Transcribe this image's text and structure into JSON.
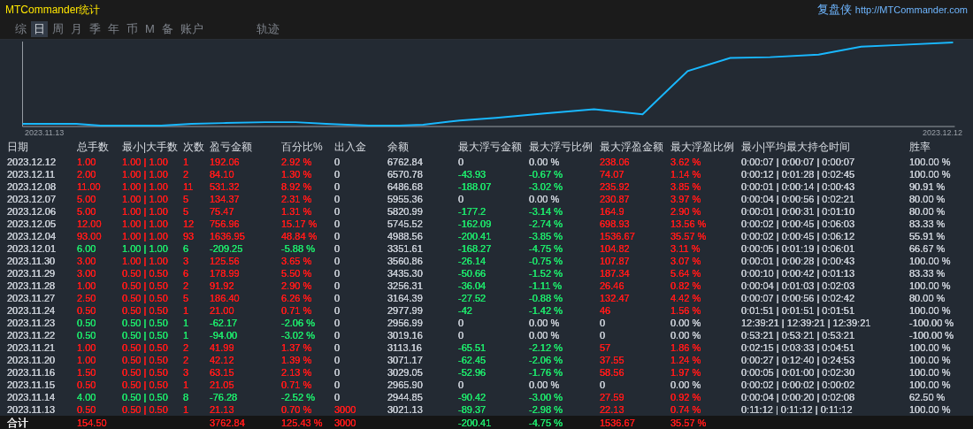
{
  "window": {
    "title": "MTCommander统计",
    "brand": "复盘侠",
    "url": "http://MTCommander.com"
  },
  "period_tabs": [
    {
      "label": "综",
      "selected": false
    },
    {
      "label": "日",
      "selected": true
    },
    {
      "label": "周",
      "selected": false
    },
    {
      "label": "月",
      "selected": false
    },
    {
      "label": "季",
      "selected": false
    },
    {
      "label": "年",
      "selected": false
    },
    {
      "label": "币",
      "selected": false
    },
    {
      "label": "M",
      "selected": false
    },
    {
      "label": "备",
      "selected": false
    },
    {
      "label": "账户",
      "selected": false
    }
  ],
  "view_tabs": [
    {
      "label": "轨迹",
      "selected": false
    }
  ],
  "chart": {
    "start_label": "2023.11.13",
    "end_label": "2023.12.12"
  },
  "table": {
    "columns": [
      "日期",
      "总手数",
      "最小|大手数",
      "次数",
      "盈亏金额",
      "百分比%",
      "出入金",
      "余额",
      "最大浮亏金额",
      "最大浮亏比例",
      "最大浮盈金额",
      "最大浮盈比例",
      "最小|平均最大持仓时间",
      "胜率"
    ],
    "rows": [
      [
        {
          "text": "2023.12.12",
          "color": "#c3c8d0"
        },
        {
          "text": "1.00",
          "color": "#ff1a1a"
        },
        {
          "text": "1.00 | 1.00",
          "color": "#ff1a1a"
        },
        {
          "text": "1",
          "color": "#ff1a1a"
        },
        {
          "text": "192.06",
          "color": "#ff1a1a"
        },
        {
          "text": "2.92 %",
          "color": "#ff1a1a"
        },
        {
          "text": "0",
          "color": "#c3c8d0"
        },
        {
          "text": "6762.84",
          "color": "#c3c8d0"
        },
        {
          "text": "0",
          "color": "#c3c8d0"
        },
        {
          "text": "0.00 %",
          "color": "#c3c8d0"
        },
        {
          "text": "238.06",
          "color": "#ff1a1a"
        },
        {
          "text": "3.62 %",
          "color": "#ff1a1a"
        },
        {
          "text": "0:00:07 | 0:00:07 | 0:00:07",
          "color": "#c3c8d0"
        },
        {
          "text": "100.00 %",
          "color": "#c3c8d0"
        }
      ],
      [
        {
          "text": "2023.12.11",
          "color": "#c3c8d0"
        },
        {
          "text": "2.00",
          "color": "#ff1a1a"
        },
        {
          "text": "1.00 | 1.00",
          "color": "#ff1a1a"
        },
        {
          "text": "2",
          "color": "#ff1a1a"
        },
        {
          "text": "84.10",
          "color": "#ff1a1a"
        },
        {
          "text": "1.30 %",
          "color": "#ff1a1a"
        },
        {
          "text": "0",
          "color": "#c3c8d0"
        },
        {
          "text": "6570.78",
          "color": "#c3c8d0"
        },
        {
          "text": "-43.93",
          "color": "#1ee36a"
        },
        {
          "text": "-0.67 %",
          "color": "#1ee36a"
        },
        {
          "text": "74.07",
          "color": "#ff1a1a"
        },
        {
          "text": "1.14 %",
          "color": "#ff1a1a"
        },
        {
          "text": "0:00:12 | 0:01:28 | 0:02:45",
          "color": "#c3c8d0"
        },
        {
          "text": "100.00 %",
          "color": "#c3c8d0"
        }
      ],
      [
        {
          "text": "2023.12.08",
          "color": "#c3c8d0"
        },
        {
          "text": "11.00",
          "color": "#ff1a1a"
        },
        {
          "text": "1.00 | 1.00",
          "color": "#ff1a1a"
        },
        {
          "text": "11",
          "color": "#ff1a1a"
        },
        {
          "text": "531.32",
          "color": "#ff1a1a"
        },
        {
          "text": "8.92 %",
          "color": "#ff1a1a"
        },
        {
          "text": "0",
          "color": "#c3c8d0"
        },
        {
          "text": "6486.68",
          "color": "#c3c8d0"
        },
        {
          "text": "-188.07",
          "color": "#1ee36a"
        },
        {
          "text": "-3.02 %",
          "color": "#1ee36a"
        },
        {
          "text": "235.92",
          "color": "#ff1a1a"
        },
        {
          "text": "3.85 %",
          "color": "#ff1a1a"
        },
        {
          "text": "0:00:01 | 0:00:14 | 0:00:43",
          "color": "#c3c8d0"
        },
        {
          "text": "90.91 %",
          "color": "#c3c8d0"
        }
      ],
      [
        {
          "text": "2023.12.07",
          "color": "#c3c8d0"
        },
        {
          "text": "5.00",
          "color": "#ff1a1a"
        },
        {
          "text": "1.00 | 1.00",
          "color": "#ff1a1a"
        },
        {
          "text": "5",
          "color": "#ff1a1a"
        },
        {
          "text": "134.37",
          "color": "#ff1a1a"
        },
        {
          "text": "2.31 %",
          "color": "#ff1a1a"
        },
        {
          "text": "0",
          "color": "#c3c8d0"
        },
        {
          "text": "5955.36",
          "color": "#c3c8d0"
        },
        {
          "text": "0",
          "color": "#c3c8d0"
        },
        {
          "text": "0.00 %",
          "color": "#c3c8d0"
        },
        {
          "text": "230.87",
          "color": "#ff1a1a"
        },
        {
          "text": "3.97 %",
          "color": "#ff1a1a"
        },
        {
          "text": "0:00:04 | 0:00:56 | 0:02:21",
          "color": "#c3c8d0"
        },
        {
          "text": "80.00 %",
          "color": "#c3c8d0"
        }
      ],
      [
        {
          "text": "2023.12.06",
          "color": "#c3c8d0"
        },
        {
          "text": "5.00",
          "color": "#ff1a1a"
        },
        {
          "text": "1.00 | 1.00",
          "color": "#ff1a1a"
        },
        {
          "text": "5",
          "color": "#ff1a1a"
        },
        {
          "text": "75.47",
          "color": "#ff1a1a"
        },
        {
          "text": "1.31 %",
          "color": "#ff1a1a"
        },
        {
          "text": "0",
          "color": "#c3c8d0"
        },
        {
          "text": "5820.99",
          "color": "#c3c8d0"
        },
        {
          "text": "-177.2",
          "color": "#1ee36a"
        },
        {
          "text": "-3.14 %",
          "color": "#1ee36a"
        },
        {
          "text": "164.9",
          "color": "#ff1a1a"
        },
        {
          "text": "2.90 %",
          "color": "#ff1a1a"
        },
        {
          "text": "0:00:01 | 0:00:31 | 0:01:10",
          "color": "#c3c8d0"
        },
        {
          "text": "80.00 %",
          "color": "#c3c8d0"
        }
      ],
      [
        {
          "text": "2023.12.05",
          "color": "#c3c8d0"
        },
        {
          "text": "12.00",
          "color": "#ff1a1a"
        },
        {
          "text": "1.00 | 1.00",
          "color": "#ff1a1a"
        },
        {
          "text": "12",
          "color": "#ff1a1a"
        },
        {
          "text": "756.96",
          "color": "#ff1a1a"
        },
        {
          "text": "15.17 %",
          "color": "#ff1a1a"
        },
        {
          "text": "0",
          "color": "#c3c8d0"
        },
        {
          "text": "5745.52",
          "color": "#c3c8d0"
        },
        {
          "text": "-162.09",
          "color": "#1ee36a"
        },
        {
          "text": "-2.74 %",
          "color": "#1ee36a"
        },
        {
          "text": "698.93",
          "color": "#ff1a1a"
        },
        {
          "text": "13.56 %",
          "color": "#ff1a1a"
        },
        {
          "text": "0:00:02 | 0:00:45 | 0:06:03",
          "color": "#c3c8d0"
        },
        {
          "text": "83.33 %",
          "color": "#c3c8d0"
        }
      ],
      [
        {
          "text": "2023.12.04",
          "color": "#c3c8d0"
        },
        {
          "text": "93.00",
          "color": "#ff1a1a"
        },
        {
          "text": "1.00 | 1.00",
          "color": "#ff1a1a"
        },
        {
          "text": "93",
          "color": "#ff1a1a"
        },
        {
          "text": "1636.95",
          "color": "#ff1a1a"
        },
        {
          "text": "48.84 %",
          "color": "#ff1a1a"
        },
        {
          "text": "0",
          "color": "#c3c8d0"
        },
        {
          "text": "4988.56",
          "color": "#c3c8d0"
        },
        {
          "text": "-200.41",
          "color": "#1ee36a"
        },
        {
          "text": "-3.85 %",
          "color": "#1ee36a"
        },
        {
          "text": "1536.67",
          "color": "#ff1a1a"
        },
        {
          "text": "35.57 %",
          "color": "#ff1a1a"
        },
        {
          "text": "0:00:02 | 0:00:45 | 0:06:12",
          "color": "#c3c8d0"
        },
        {
          "text": "55.91 %",
          "color": "#c3c8d0"
        }
      ],
      [
        {
          "text": "2023.12.01",
          "color": "#c3c8d0"
        },
        {
          "text": "6.00",
          "color": "#1ee36a"
        },
        {
          "text": "1.00 | 1.00",
          "color": "#1ee36a"
        },
        {
          "text": "6",
          "color": "#1ee36a"
        },
        {
          "text": "-209.25",
          "color": "#1ee36a"
        },
        {
          "text": "-5.88 %",
          "color": "#1ee36a"
        },
        {
          "text": "0",
          "color": "#c3c8d0"
        },
        {
          "text": "3351.61",
          "color": "#c3c8d0"
        },
        {
          "text": "-168.27",
          "color": "#1ee36a"
        },
        {
          "text": "-4.75 %",
          "color": "#1ee36a"
        },
        {
          "text": "104.82",
          "color": "#ff1a1a"
        },
        {
          "text": "3.11 %",
          "color": "#ff1a1a"
        },
        {
          "text": "0:00:05 | 0:01:19 | 0:06:01",
          "color": "#c3c8d0"
        },
        {
          "text": "66.67 %",
          "color": "#c3c8d0"
        }
      ],
      [
        {
          "text": "2023.11.30",
          "color": "#c3c8d0"
        },
        {
          "text": "3.00",
          "color": "#ff1a1a"
        },
        {
          "text": "1.00 | 1.00",
          "color": "#ff1a1a"
        },
        {
          "text": "3",
          "color": "#ff1a1a"
        },
        {
          "text": "125.56",
          "color": "#ff1a1a"
        },
        {
          "text": "3.65 %",
          "color": "#ff1a1a"
        },
        {
          "text": "0",
          "color": "#c3c8d0"
        },
        {
          "text": "3560.86",
          "color": "#c3c8d0"
        },
        {
          "text": "-26.14",
          "color": "#1ee36a"
        },
        {
          "text": "-0.75 %",
          "color": "#1ee36a"
        },
        {
          "text": "107.87",
          "color": "#ff1a1a"
        },
        {
          "text": "3.07 %",
          "color": "#ff1a1a"
        },
        {
          "text": "0:00:01 | 0:00:28 | 0:00:43",
          "color": "#c3c8d0"
        },
        {
          "text": "100.00 %",
          "color": "#c3c8d0"
        }
      ],
      [
        {
          "text": "2023.11.29",
          "color": "#c3c8d0"
        },
        {
          "text": "3.00",
          "color": "#ff1a1a"
        },
        {
          "text": "0.50 | 0.50",
          "color": "#ff1a1a"
        },
        {
          "text": "6",
          "color": "#ff1a1a"
        },
        {
          "text": "178.99",
          "color": "#ff1a1a"
        },
        {
          "text": "5.50 %",
          "color": "#ff1a1a"
        },
        {
          "text": "0",
          "color": "#c3c8d0"
        },
        {
          "text": "3435.30",
          "color": "#c3c8d0"
        },
        {
          "text": "-50.66",
          "color": "#1ee36a"
        },
        {
          "text": "-1.52 %",
          "color": "#1ee36a"
        },
        {
          "text": "187.34",
          "color": "#ff1a1a"
        },
        {
          "text": "5.64 %",
          "color": "#ff1a1a"
        },
        {
          "text": "0:00:10 | 0:00:42 | 0:01:13",
          "color": "#c3c8d0"
        },
        {
          "text": "83.33 %",
          "color": "#c3c8d0"
        }
      ],
      [
        {
          "text": "2023.11.28",
          "color": "#c3c8d0"
        },
        {
          "text": "1.00",
          "color": "#ff1a1a"
        },
        {
          "text": "0.50 | 0.50",
          "color": "#ff1a1a"
        },
        {
          "text": "2",
          "color": "#ff1a1a"
        },
        {
          "text": "91.92",
          "color": "#ff1a1a"
        },
        {
          "text": "2.90 %",
          "color": "#ff1a1a"
        },
        {
          "text": "0",
          "color": "#c3c8d0"
        },
        {
          "text": "3256.31",
          "color": "#c3c8d0"
        },
        {
          "text": "-36.04",
          "color": "#1ee36a"
        },
        {
          "text": "-1.11 %",
          "color": "#1ee36a"
        },
        {
          "text": "26.46",
          "color": "#ff1a1a"
        },
        {
          "text": "0.82 %",
          "color": "#ff1a1a"
        },
        {
          "text": "0:00:04 | 0:01:03 | 0:02:03",
          "color": "#c3c8d0"
        },
        {
          "text": "100.00 %",
          "color": "#c3c8d0"
        }
      ],
      [
        {
          "text": "2023.11.27",
          "color": "#c3c8d0"
        },
        {
          "text": "2.50",
          "color": "#ff1a1a"
        },
        {
          "text": "0.50 | 0.50",
          "color": "#ff1a1a"
        },
        {
          "text": "5",
          "color": "#ff1a1a"
        },
        {
          "text": "186.40",
          "color": "#ff1a1a"
        },
        {
          "text": "6.26 %",
          "color": "#ff1a1a"
        },
        {
          "text": "0",
          "color": "#c3c8d0"
        },
        {
          "text": "3164.39",
          "color": "#c3c8d0"
        },
        {
          "text": "-27.52",
          "color": "#1ee36a"
        },
        {
          "text": "-0.88 %",
          "color": "#1ee36a"
        },
        {
          "text": "132.47",
          "color": "#ff1a1a"
        },
        {
          "text": "4.42 %",
          "color": "#ff1a1a"
        },
        {
          "text": "0:00:07 | 0:00:56 | 0:02:42",
          "color": "#c3c8d0"
        },
        {
          "text": "80.00 %",
          "color": "#c3c8d0"
        }
      ],
      [
        {
          "text": "2023.11.24",
          "color": "#c3c8d0"
        },
        {
          "text": "0.50",
          "color": "#ff1a1a"
        },
        {
          "text": "0.50 | 0.50",
          "color": "#ff1a1a"
        },
        {
          "text": "1",
          "color": "#ff1a1a"
        },
        {
          "text": "21.00",
          "color": "#ff1a1a"
        },
        {
          "text": "0.71 %",
          "color": "#ff1a1a"
        },
        {
          "text": "0",
          "color": "#c3c8d0"
        },
        {
          "text": "2977.99",
          "color": "#c3c8d0"
        },
        {
          "text": "-42",
          "color": "#1ee36a"
        },
        {
          "text": "-1.42 %",
          "color": "#1ee36a"
        },
        {
          "text": "46",
          "color": "#ff1a1a"
        },
        {
          "text": "1.56 %",
          "color": "#ff1a1a"
        },
        {
          "text": "0:01:51 | 0:01:51 | 0:01:51",
          "color": "#c3c8d0"
        },
        {
          "text": "100.00 %",
          "color": "#c3c8d0"
        }
      ],
      [
        {
          "text": "2023.11.23",
          "color": "#c3c8d0"
        },
        {
          "text": "0.50",
          "color": "#1ee36a"
        },
        {
          "text": "0.50 | 0.50",
          "color": "#1ee36a"
        },
        {
          "text": "1",
          "color": "#1ee36a"
        },
        {
          "text": "-62.17",
          "color": "#1ee36a"
        },
        {
          "text": "-2.06 %",
          "color": "#1ee36a"
        },
        {
          "text": "0",
          "color": "#c3c8d0"
        },
        {
          "text": "2956.99",
          "color": "#c3c8d0"
        },
        {
          "text": "0",
          "color": "#c3c8d0"
        },
        {
          "text": "0.00 %",
          "color": "#c3c8d0"
        },
        {
          "text": "0",
          "color": "#c3c8d0"
        },
        {
          "text": "0.00 %",
          "color": "#c3c8d0"
        },
        {
          "text": "12:39:21 | 12:39:21 | 12:39:21",
          "color": "#c3c8d0"
        },
        {
          "text": "-100.00 %",
          "color": "#c3c8d0"
        }
      ],
      [
        {
          "text": "2023.11.22",
          "color": "#c3c8d0"
        },
        {
          "text": "0.50",
          "color": "#1ee36a"
        },
        {
          "text": "0.50 | 0.50",
          "color": "#1ee36a"
        },
        {
          "text": "1",
          "color": "#1ee36a"
        },
        {
          "text": "-94.00",
          "color": "#1ee36a"
        },
        {
          "text": "-3.02 %",
          "color": "#1ee36a"
        },
        {
          "text": "0",
          "color": "#c3c8d0"
        },
        {
          "text": "3019.16",
          "color": "#c3c8d0"
        },
        {
          "text": "0",
          "color": "#c3c8d0"
        },
        {
          "text": "0.00 %",
          "color": "#c3c8d0"
        },
        {
          "text": "0",
          "color": "#c3c8d0"
        },
        {
          "text": "0.00 %",
          "color": "#c3c8d0"
        },
        {
          "text": "0:53:21 | 0:53:21 | 0:53:21",
          "color": "#c3c8d0"
        },
        {
          "text": "-100.00 %",
          "color": "#c3c8d0"
        }
      ],
      [
        {
          "text": "2023.11.21",
          "color": "#c3c8d0"
        },
        {
          "text": "1.00",
          "color": "#ff1a1a"
        },
        {
          "text": "0.50 | 0.50",
          "color": "#ff1a1a"
        },
        {
          "text": "2",
          "color": "#ff1a1a"
        },
        {
          "text": "41.99",
          "color": "#ff1a1a"
        },
        {
          "text": "1.37 %",
          "color": "#ff1a1a"
        },
        {
          "text": "0",
          "color": "#c3c8d0"
        },
        {
          "text": "3113.16",
          "color": "#c3c8d0"
        },
        {
          "text": "-65.51",
          "color": "#1ee36a"
        },
        {
          "text": "-2.12 %",
          "color": "#1ee36a"
        },
        {
          "text": "57",
          "color": "#ff1a1a"
        },
        {
          "text": "1.86 %",
          "color": "#ff1a1a"
        },
        {
          "text": "0:02:15 | 0:03:33 | 0:04:51",
          "color": "#c3c8d0"
        },
        {
          "text": "100.00 %",
          "color": "#c3c8d0"
        }
      ],
      [
        {
          "text": "2023.11.20",
          "color": "#c3c8d0"
        },
        {
          "text": "1.00",
          "color": "#ff1a1a"
        },
        {
          "text": "0.50 | 0.50",
          "color": "#ff1a1a"
        },
        {
          "text": "2",
          "color": "#ff1a1a"
        },
        {
          "text": "42.12",
          "color": "#ff1a1a"
        },
        {
          "text": "1.39 %",
          "color": "#ff1a1a"
        },
        {
          "text": "0",
          "color": "#c3c8d0"
        },
        {
          "text": "3071.17",
          "color": "#c3c8d0"
        },
        {
          "text": "-62.45",
          "color": "#1ee36a"
        },
        {
          "text": "-2.06 %",
          "color": "#1ee36a"
        },
        {
          "text": "37.55",
          "color": "#ff1a1a"
        },
        {
          "text": "1.24 %",
          "color": "#ff1a1a"
        },
        {
          "text": "0:00:27 | 0:12:40 | 0:24:53",
          "color": "#c3c8d0"
        },
        {
          "text": "100.00 %",
          "color": "#c3c8d0"
        }
      ],
      [
        {
          "text": "2023.11.16",
          "color": "#c3c8d0"
        },
        {
          "text": "1.50",
          "color": "#ff1a1a"
        },
        {
          "text": "0.50 | 0.50",
          "color": "#ff1a1a"
        },
        {
          "text": "3",
          "color": "#ff1a1a"
        },
        {
          "text": "63.15",
          "color": "#ff1a1a"
        },
        {
          "text": "2.13 %",
          "color": "#ff1a1a"
        },
        {
          "text": "0",
          "color": "#c3c8d0"
        },
        {
          "text": "3029.05",
          "color": "#c3c8d0"
        },
        {
          "text": "-52.96",
          "color": "#1ee36a"
        },
        {
          "text": "-1.76 %",
          "color": "#1ee36a"
        },
        {
          "text": "58.56",
          "color": "#ff1a1a"
        },
        {
          "text": "1.97 %",
          "color": "#ff1a1a"
        },
        {
          "text": "0:00:05 | 0:01:00 | 0:02:30",
          "color": "#c3c8d0"
        },
        {
          "text": "100.00 %",
          "color": "#c3c8d0"
        }
      ],
      [
        {
          "text": "2023.11.15",
          "color": "#c3c8d0"
        },
        {
          "text": "0.50",
          "color": "#ff1a1a"
        },
        {
          "text": "0.50 | 0.50",
          "color": "#ff1a1a"
        },
        {
          "text": "1",
          "color": "#ff1a1a"
        },
        {
          "text": "21.05",
          "color": "#ff1a1a"
        },
        {
          "text": "0.71 %",
          "color": "#ff1a1a"
        },
        {
          "text": "0",
          "color": "#c3c8d0"
        },
        {
          "text": "2965.90",
          "color": "#c3c8d0"
        },
        {
          "text": "0",
          "color": "#c3c8d0"
        },
        {
          "text": "0.00 %",
          "color": "#c3c8d0"
        },
        {
          "text": "0",
          "color": "#c3c8d0"
        },
        {
          "text": "0.00 %",
          "color": "#c3c8d0"
        },
        {
          "text": "0:00:02 | 0:00:02 | 0:00:02",
          "color": "#c3c8d0"
        },
        {
          "text": "100.00 %",
          "color": "#c3c8d0"
        }
      ],
      [
        {
          "text": "2023.11.14",
          "color": "#c3c8d0"
        },
        {
          "text": "4.00",
          "color": "#1ee36a"
        },
        {
          "text": "0.50 | 0.50",
          "color": "#1ee36a"
        },
        {
          "text": "8",
          "color": "#1ee36a"
        },
        {
          "text": "-76.28",
          "color": "#1ee36a"
        },
        {
          "text": "-2.52 %",
          "color": "#1ee36a"
        },
        {
          "text": "0",
          "color": "#c3c8d0"
        },
        {
          "text": "2944.85",
          "color": "#c3c8d0"
        },
        {
          "text": "-90.42",
          "color": "#1ee36a"
        },
        {
          "text": "-3.00 %",
          "color": "#1ee36a"
        },
        {
          "text": "27.59",
          "color": "#ff1a1a"
        },
        {
          "text": "0.92 %",
          "color": "#ff1a1a"
        },
        {
          "text": "0:00:04 | 0:00:20 | 0:02:08",
          "color": "#c3c8d0"
        },
        {
          "text": "62.50 %",
          "color": "#c3c8d0"
        }
      ],
      [
        {
          "text": "2023.11.13",
          "color": "#c3c8d0"
        },
        {
          "text": "0.50",
          "color": "#ff1a1a"
        },
        {
          "text": "0.50 | 0.50",
          "color": "#ff1a1a"
        },
        {
          "text": "1",
          "color": "#ff1a1a"
        },
        {
          "text": "21.13",
          "color": "#ff1a1a"
        },
        {
          "text": "0.70 %",
          "color": "#ff1a1a"
        },
        {
          "text": "3000",
          "color": "#ff1a1a"
        },
        {
          "text": "3021.13",
          "color": "#c3c8d0"
        },
        {
          "text": "-89.37",
          "color": "#1ee36a"
        },
        {
          "text": "-2.98 %",
          "color": "#1ee36a"
        },
        {
          "text": "22.13",
          "color": "#ff1a1a"
        },
        {
          "text": "0.74 %",
          "color": "#ff1a1a"
        },
        {
          "text": "0:11:12 | 0:11:12 | 0:11:12",
          "color": "#c3c8d0"
        },
        {
          "text": "100.00 %",
          "color": "#c3c8d0"
        }
      ]
    ],
    "total": {
      "label": {
        "text": "合计",
        "color": "#e8e8e8"
      },
      "lots": {
        "text": "154.50",
        "color": "#ff1a1a"
      },
      "profit": {
        "text": "3762.84",
        "color": "#ff1a1a"
      },
      "percent": {
        "text": "125.43 %",
        "color": "#ff1a1a"
      },
      "deposit": {
        "text": "3000",
        "color": "#ff1a1a"
      },
      "max_float_loss": {
        "text": "-200.41",
        "color": "#1ee36a"
      },
      "max_float_loss_ratio": {
        "text": "-4.75 %",
        "color": "#1ee36a"
      },
      "max_float_profit": {
        "text": "1536.67",
        "color": "#ff1a1a"
      },
      "max_float_profit_ratio": {
        "text": "35.57 %",
        "color": "#ff1a1a"
      }
    }
  }
}
